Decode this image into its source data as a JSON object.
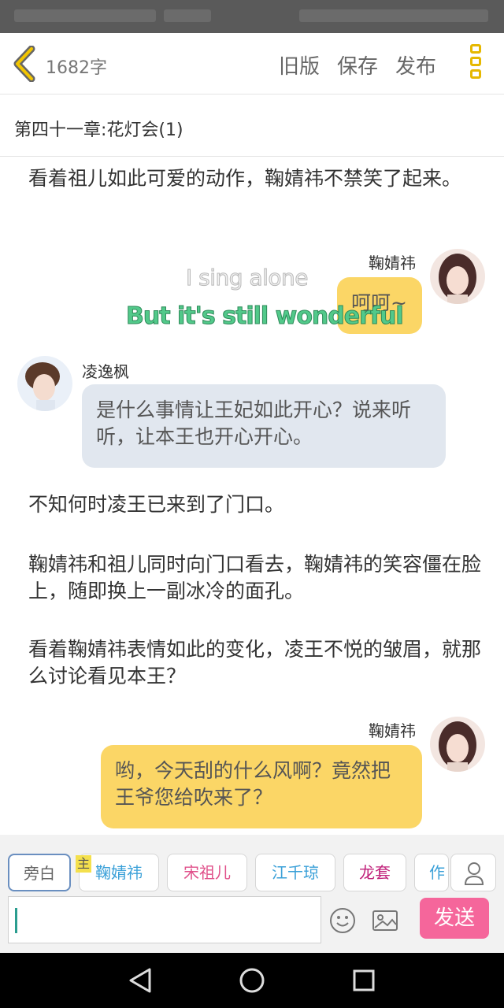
{
  "topbar": {
    "word_count": "1682字",
    "old_version": "旧版",
    "save": "保存",
    "publish": "发布"
  },
  "chapter": {
    "title": "第四十一章:花灯会(1)"
  },
  "messages": [
    {
      "type": "narration",
      "text": "看着祖儿如此可爱的动作，鞠婧祎不禁笑了起来。"
    },
    {
      "type": "right",
      "name": "鞠婧祎",
      "text": "呵呵~"
    },
    {
      "type": "left",
      "name": "凌逸枫",
      "text": "是什么事情让王妃如此开心？说来听听，让本王也开心开心。"
    },
    {
      "type": "narration",
      "text": "不知何时凌王已来到了门口。"
    },
    {
      "type": "narration",
      "text": "鞠婧祎和祖儿同时向门口看去，鞠婧祎的笑容僵在脸上，随即换上一副冰冷的面孔。"
    },
    {
      "type": "narration",
      "text": "看着鞠婧祎表情如此的变化，凌王不悦的皱眉，就那么讨论看见本王？"
    },
    {
      "type": "right",
      "name": "鞠婧祎",
      "text": "哟，今天刮的什么风啊？竟然把王爷您给吹来了？"
    }
  ],
  "overlay": {
    "line1": "I sing alone",
    "line2": "But it's still wonderful"
  },
  "characters": {
    "items": [
      "旁白",
      "鞠婧祎",
      "宋祖儿",
      "江千琼",
      "龙套",
      "作"
    ],
    "colors": [
      "#666666",
      "#3aa0d8",
      "#e0508a",
      "#3aa0d8",
      "#c0207a",
      "#3aa0d8"
    ],
    "main_tag": "主"
  },
  "input": {
    "placeholder": "",
    "value": ""
  },
  "send_label": "发送",
  "icons": [
    "back-chevron-icon",
    "more-icon",
    "user-icon",
    "emoji-icon",
    "image-icon",
    "back-nav-icon",
    "home-nav-icon",
    "recent-nav-icon"
  ]
}
